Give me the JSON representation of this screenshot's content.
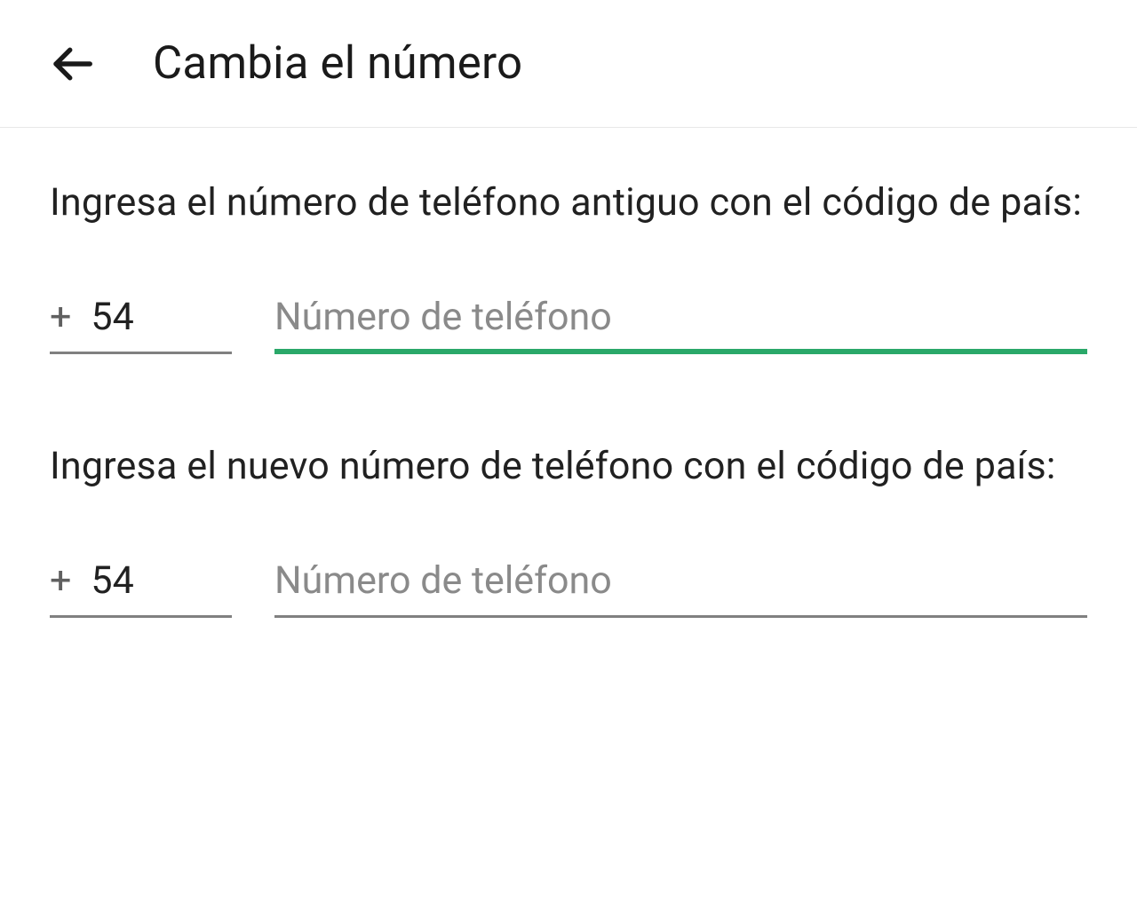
{
  "header": {
    "title": "Cambia el número"
  },
  "sections": {
    "old_number": {
      "label": "Ingresa el número de teléfono antiguo con el código de país:",
      "country_code": "54",
      "phone_placeholder": "Número de teléfono",
      "phone_value": ""
    },
    "new_number": {
      "label": "Ingresa el nuevo número de teléfono con el código de país:",
      "country_code": "54",
      "phone_placeholder": "Número de teléfono",
      "phone_value": ""
    }
  },
  "colors": {
    "accent": "#2aa869",
    "text_primary": "#212121",
    "text_secondary": "#606060",
    "placeholder": "#8a8a8a",
    "underline": "#808080"
  }
}
